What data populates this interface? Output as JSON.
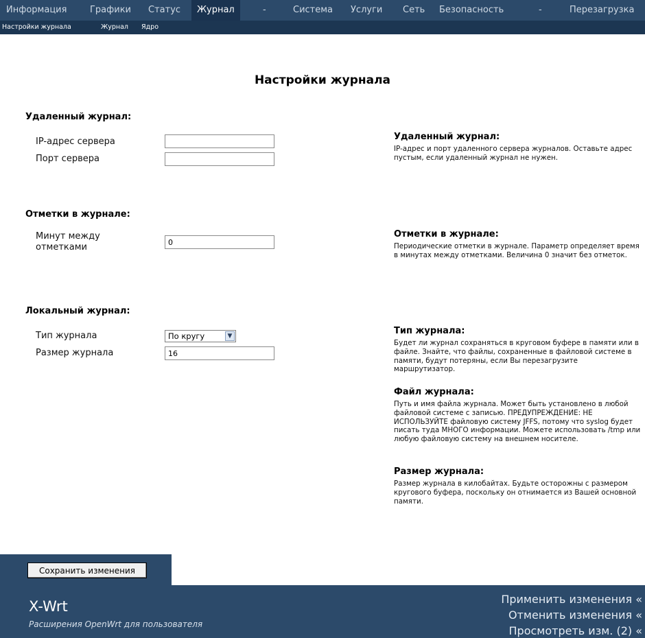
{
  "topnav": {
    "items": [
      {
        "label": "Информация"
      },
      {
        "label": "Графики"
      },
      {
        "label": "Статус"
      },
      {
        "label": "Журнал"
      },
      {
        "label": "-"
      },
      {
        "label": "Система"
      },
      {
        "label": "Услуги"
      },
      {
        "label": "Сеть"
      },
      {
        "label": "Безопасность"
      },
      {
        "label": "-"
      },
      {
        "label": "Перезагрузка"
      }
    ]
  },
  "subnav": {
    "items": [
      {
        "label": "Настройки журнала"
      },
      {
        "label": "Журнал"
      },
      {
        "label": "Ядро"
      }
    ]
  },
  "page": {
    "title": "Настройки журнала"
  },
  "sections": {
    "remote": {
      "title": "Удаленный журнал:",
      "server_ip_label": "IP-адрес сервера",
      "server_ip_value": "",
      "server_port_label": "Порт сервера",
      "server_port_value": ""
    },
    "marks": {
      "title": "Отметки в журнале:",
      "minutes_label_1": "Минут между",
      "minutes_label_2": "отметками",
      "minutes_value": "0"
    },
    "local": {
      "title": "Локальный журнал:",
      "type_label": "Тип журнала",
      "type_value": "По кругу",
      "size_label": "Размер журнала",
      "size_value": "16"
    }
  },
  "help": {
    "remote_title": "Удаленный журнал:",
    "remote_text": "IP-адрес и порт удаленного сервера журналов. Оставьте адрес пустым, если удаленный журнал не нужен.",
    "marks_title": "Отметки в журнале:",
    "marks_text": "Периодические отметки в журнале. Параметр определяет время в минутах между отметками. Величина 0 значит без отметок.",
    "type_title": "Тип журнала:",
    "type_text": "Будет ли журнал сохраняться в круговом буфере в памяти или в файле. Знайте, что файлы, сохраненные в файловой системе в памяти, будут потеряны, если Вы перезагрузите маршрутизатор.",
    "file_title": "Файл журнала:",
    "file_text": "Путь и имя файла журнала. Может быть установлено в любой файловой системе с записью. ПРЕДУПРЕЖДЕНИЕ: НЕ ИСПОЛЬЗУЙТЕ файловую систему JFFS, потому что syslog будет писать туда МНОГО информации. Можете использовать /tmp или любую файловую систему на внешнем носителе.",
    "size_title": "Размер журнала:",
    "size_text": "Размер журнала в килобайтах. Будьте осторожны с размером кругового буфера, поскольку он отнимается из Вашей основной памяти."
  },
  "actions": {
    "save_label": "Сохранить изменения"
  },
  "footer": {
    "brand": "X-Wrt",
    "tagline": "Расширения OpenWrt для пользователя",
    "apply": "Применить изменения «",
    "cancel": "Отменить изменения «",
    "review": "Просмотреть изм. (2) «"
  },
  "colors": {
    "nav_bg": "#2c4a6a",
    "subnav_bg": "#1c3652",
    "active_tab_bg": "#1a3350",
    "footer_bg": "#2c4a6a"
  },
  "icons": {
    "select_arrow": "chevron-down-icon"
  }
}
